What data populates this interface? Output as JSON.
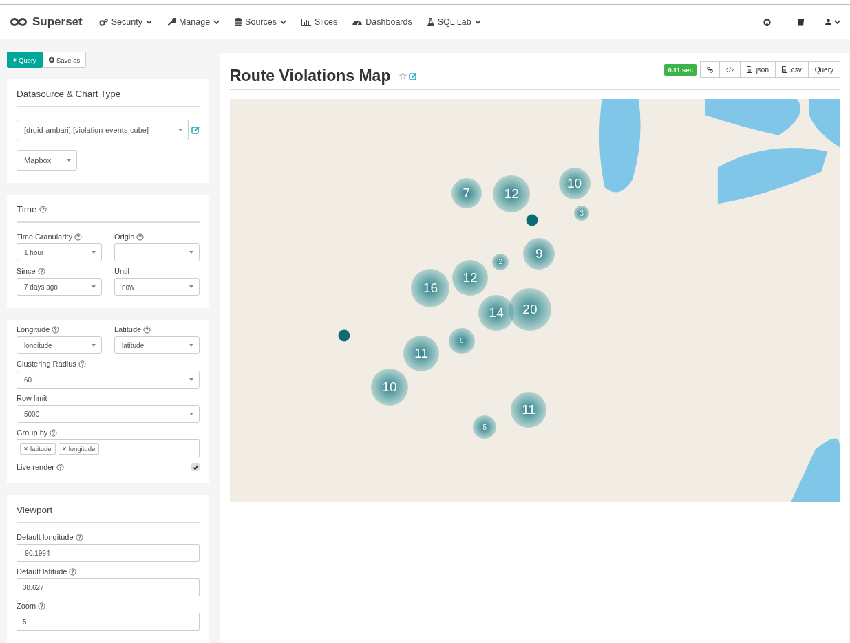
{
  "navbar": {
    "brand": "Superset",
    "menus": [
      {
        "label": "Security",
        "dropdown": true
      },
      {
        "label": "Manage",
        "dropdown": true
      },
      {
        "label": "Sources",
        "dropdown": true
      },
      {
        "label": "Slices",
        "dropdown": false
      },
      {
        "label": "Dashboards",
        "dropdown": false
      },
      {
        "label": "SQL Lab",
        "dropdown": true
      }
    ]
  },
  "actions": [
    {
      "label": "Query",
      "selected": true
    },
    {
      "label": "Save as",
      "selected": false
    }
  ],
  "sections": [
    {
      "title": "Datasource & Chart Type",
      "help": false,
      "rows": [
        [
          {
            "kind": "datasource",
            "value": "[druid-ambari].[violation-events-cube]"
          }
        ],
        [
          {
            "kind": "select_small",
            "value": "Mapbox"
          }
        ]
      ]
    },
    {
      "title": "Time",
      "help": true,
      "rows": [
        [
          {
            "kind": "select",
            "label": "Time Granularity",
            "help": true,
            "value": "1 hour"
          },
          {
            "kind": "select",
            "label": "Origin",
            "help": true
          }
        ],
        [
          {
            "kind": "select",
            "label": "Since",
            "help": true,
            "value": "7 days ago"
          },
          {
            "kind": "select",
            "label": "Until",
            "help": false,
            "value": "now"
          }
        ]
      ]
    },
    {
      "rows": [
        [
          {
            "kind": "select",
            "label": "Longitude",
            "help": true,
            "value": "longitude"
          },
          {
            "kind": "select",
            "label": "Latitude",
            "help": true,
            "value": "latitude"
          }
        ],
        [
          {
            "kind": "select",
            "label": "Clustering Radius",
            "help": true,
            "value": "60"
          }
        ],
        [
          {
            "kind": "select",
            "label": "Row limit",
            "help": false,
            "value": "5000"
          }
        ],
        [
          {
            "kind": "tags",
            "label": "Group by",
            "help": true,
            "tags": [
              "latitude",
              "longitude"
            ]
          }
        ],
        [
          {
            "kind": "checkbox",
            "label": "Live render",
            "help": true,
            "checked": true
          }
        ]
      ]
    },
    {
      "title": "Viewport",
      "help": false,
      "rows": [
        [
          {
            "kind": "input",
            "label": "Default longitude",
            "help": true,
            "value": "-90.1994"
          }
        ],
        [
          {
            "kind": "input",
            "label": "Default latitude",
            "help": true,
            "value": "38.627"
          }
        ],
        [
          {
            "kind": "input",
            "label": "Zoom",
            "help": true,
            "value": "5"
          }
        ]
      ]
    }
  ],
  "chart": {
    "title": "Route Violations Map",
    "timing": "0.11 sec",
    "buttons": [
      {
        "kind": "link"
      },
      {
        "kind": "embed"
      },
      {
        "kind": "export",
        "label": ".json"
      },
      {
        "kind": "export",
        "label": ".csv"
      },
      {
        "kind": "query",
        "label": "Query"
      }
    ],
    "clusters": [
      {
        "kind": "cluster",
        "count": "7"
      },
      {
        "kind": "cluster",
        "count": "12"
      },
      {
        "kind": "cluster",
        "count": "10"
      },
      {
        "kind": "cluster",
        "count": "3"
      },
      {
        "kind": "point"
      },
      {
        "kind": "cluster",
        "count": "2"
      },
      {
        "kind": "cluster",
        "count": "9"
      },
      {
        "kind": "cluster",
        "count": "12"
      },
      {
        "kind": "cluster",
        "count": "16"
      },
      {
        "kind": "cluster",
        "count": "14"
      },
      {
        "kind": "cluster",
        "count": "20"
      },
      {
        "kind": "cluster",
        "count": "6"
      },
      {
        "kind": "cluster",
        "count": "11"
      },
      {
        "kind": "point"
      },
      {
        "kind": "cluster",
        "count": "10"
      },
      {
        "kind": "cluster",
        "count": "11"
      },
      {
        "kind": "cluster",
        "count": "5"
      }
    ]
  }
}
